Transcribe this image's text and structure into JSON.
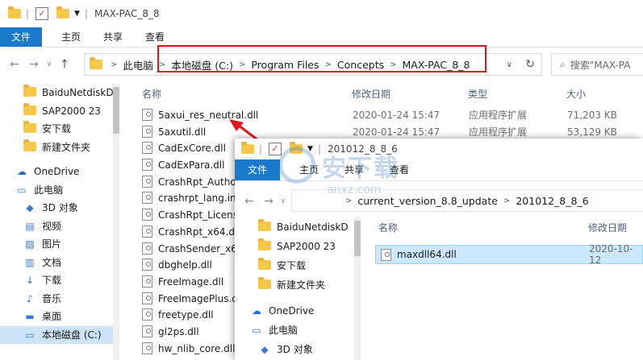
{
  "main": {
    "title": "MAX-PAC_8_8",
    "tabs": [
      "文件",
      "主页",
      "共享",
      "查看"
    ],
    "breadcrumb": [
      "此电脑",
      "本地磁盘 (C:)",
      "Program Files",
      "Concepts",
      "MAX-PAC_8_8"
    ],
    "search_placeholder": "搜索\"MAX-PA",
    "columns": {
      "name": "名称",
      "date": "修改日期",
      "type": "类型",
      "size": "大小"
    },
    "sidebar": [
      {
        "label": "BaiduNetdiskD",
        "icon": "folder-icon"
      },
      {
        "label": "SAP2000 23",
        "icon": "folder-icon"
      },
      {
        "label": "安下载",
        "icon": "folder-icon"
      },
      {
        "label": "新建文件夹",
        "icon": "folder-icon"
      },
      {
        "label": "OneDrive",
        "icon": "cloud-icon"
      },
      {
        "label": "此电脑",
        "icon": "computer-icon"
      },
      {
        "label": "3D 对象",
        "icon": "cube-icon"
      },
      {
        "label": "视频",
        "icon": "video-icon"
      },
      {
        "label": "图片",
        "icon": "picture-icon"
      },
      {
        "label": "文档",
        "icon": "document-icon"
      },
      {
        "label": "下载",
        "icon": "download-icon"
      },
      {
        "label": "音乐",
        "icon": "music-icon"
      },
      {
        "label": "桌面",
        "icon": "desktop-icon"
      },
      {
        "label": "本地磁盘 (C:)",
        "icon": "drive-icon"
      }
    ],
    "files": [
      {
        "name": "5axui_res_neutral.dll",
        "date": "2020-01-24 15:47",
        "type": "应用程序扩展",
        "size": "71,203 KB"
      },
      {
        "name": "5axutil.dll",
        "date": "2020-01-24 15:47",
        "type": "应用程序扩展",
        "size": "53,129 KB"
      },
      {
        "name": "CadExCore.dll",
        "date": "",
        "type": "",
        "size": ""
      },
      {
        "name": "CadExPara.dll",
        "date": "",
        "type": "",
        "size": ""
      },
      {
        "name": "CrashRpt_Autho",
        "date": "",
        "type": "",
        "size": ""
      },
      {
        "name": "crashrpt_lang.ini",
        "date": "",
        "type": "",
        "size": ""
      },
      {
        "name": "CrashRpt_Licens",
        "date": "",
        "type": "",
        "size": ""
      },
      {
        "name": "CrashRpt_x64.dl",
        "date": "",
        "type": "",
        "size": ""
      },
      {
        "name": "CrashSender_x6",
        "date": "",
        "type": "",
        "size": ""
      },
      {
        "name": "dbghelp.dll",
        "date": "",
        "type": "",
        "size": ""
      },
      {
        "name": "FreeImage.dll",
        "date": "",
        "type": "",
        "size": ""
      },
      {
        "name": "FreeImagePlus.d",
        "date": "",
        "type": "",
        "size": ""
      },
      {
        "name": "freetype.dll",
        "date": "",
        "type": "",
        "size": ""
      },
      {
        "name": "gl2ps.dll",
        "date": "",
        "type": "",
        "size": ""
      },
      {
        "name": "hw_nlib_core.dll",
        "date": "",
        "type": "",
        "size": ""
      }
    ]
  },
  "second": {
    "title": "201012_8_8_6",
    "tabs": [
      "文件",
      "主页",
      "共享",
      "查看"
    ],
    "breadcrumb": [
      "current_version_8.8_update",
      "201012_8_8_6"
    ],
    "columns": {
      "name": "名称",
      "date": "修改日期"
    },
    "sidebar": [
      {
        "label": "BaiduNetdiskD",
        "icon": "folder-icon"
      },
      {
        "label": "SAP2000 23",
        "icon": "folder-icon"
      },
      {
        "label": "安下载",
        "icon": "folder-icon"
      },
      {
        "label": "新建文件夹",
        "icon": "folder-icon"
      },
      {
        "label": "OneDrive",
        "icon": "cloud-icon"
      },
      {
        "label": "此电脑",
        "icon": "computer-icon"
      },
      {
        "label": "3D 对象",
        "icon": "cube-icon"
      }
    ],
    "file": {
      "name": "maxdll64.dll",
      "date": "2020-10-12"
    }
  },
  "watermark": {
    "text": "安下载",
    "sub": "anxz.com"
  },
  "colors": {
    "accent": "#1979ca",
    "highlight": "#e0161e",
    "selection": "#cce8ff"
  }
}
